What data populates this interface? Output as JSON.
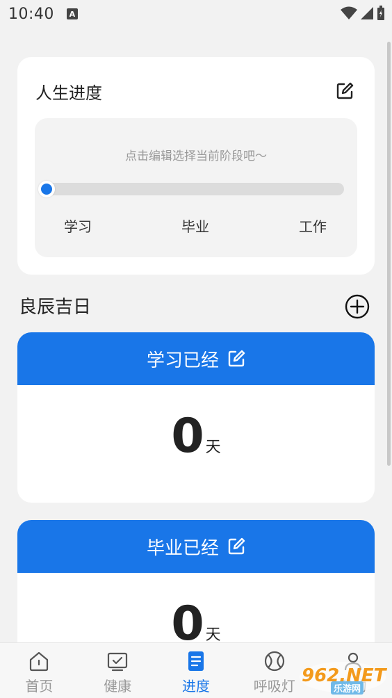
{
  "status_bar": {
    "time": "10:40",
    "notification_letter": "A"
  },
  "progress_card": {
    "title": "人生进度",
    "hint": "点击编辑选择当前阶段吧～",
    "stages": [
      "学习",
      "毕业",
      "工作"
    ],
    "current_progress": 0
  },
  "section": {
    "title": "良辰吉日"
  },
  "day_cards": [
    {
      "title": "学习已经",
      "value": "0",
      "unit": "天"
    },
    {
      "title": "毕业已经",
      "value": "0",
      "unit": "天"
    }
  ],
  "nav": {
    "items": [
      {
        "label": "首页",
        "icon": "home-icon"
      },
      {
        "label": "健康",
        "icon": "health-monitor-icon"
      },
      {
        "label": "进度",
        "icon": "progress-document-icon"
      },
      {
        "label": "呼吸灯",
        "icon": "ball-icon"
      },
      {
        "label": "我的",
        "icon": "profile-icon"
      }
    ],
    "active_index": 2
  },
  "watermark": {
    "text": "962.NET",
    "subtext": "乐游网"
  },
  "colors": {
    "accent": "#1976e8",
    "background": "#f2f2f2",
    "card": "#ffffff"
  }
}
